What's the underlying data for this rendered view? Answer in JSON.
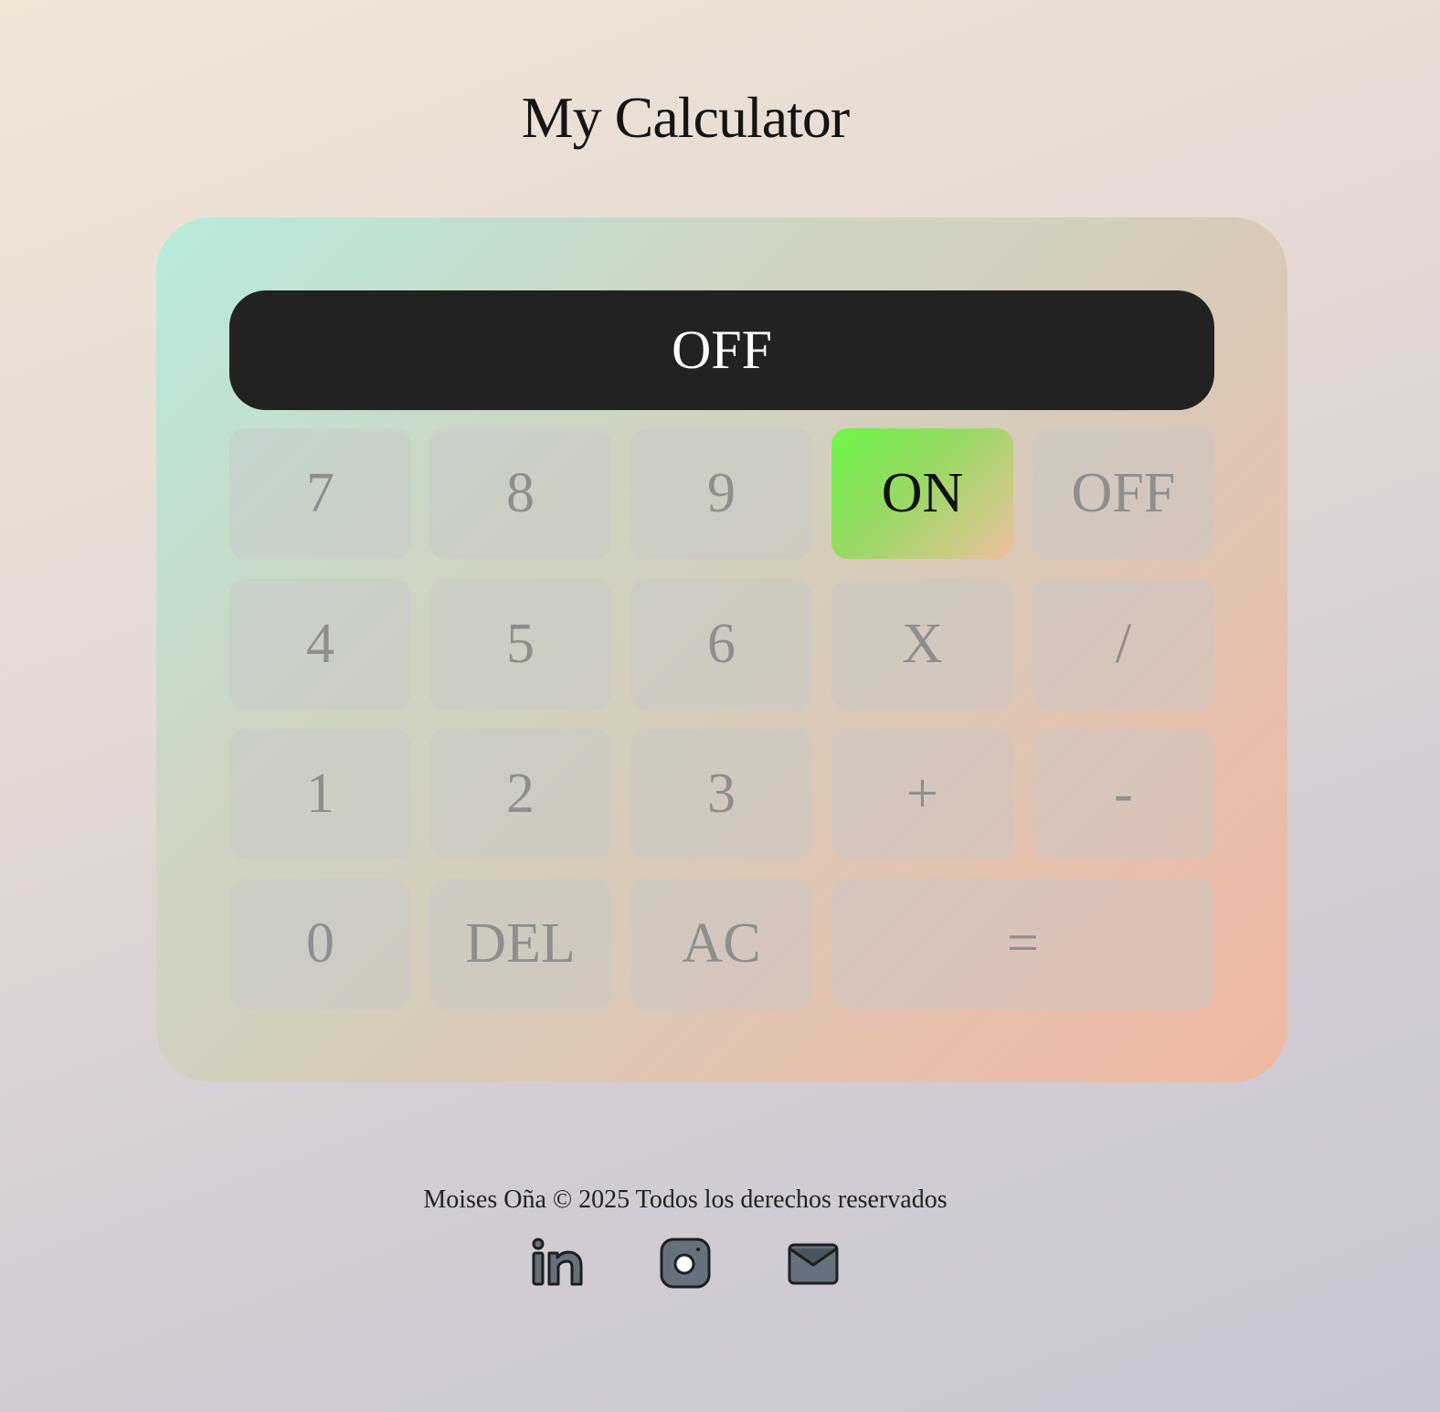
{
  "header": {
    "title": "My Calculator"
  },
  "display": {
    "value": "OFF"
  },
  "keys": {
    "k7": "7",
    "k8": "8",
    "k9": "9",
    "on": "ON",
    "off": "OFF",
    "k4": "4",
    "k5": "5",
    "k6": "6",
    "multiply": "X",
    "divide": "/",
    "k1": "1",
    "k2": "2",
    "k3": "3",
    "plus": "+",
    "minus": "-",
    "k0": "0",
    "del": "DEL",
    "ac": "AC",
    "equals": "="
  },
  "footer": {
    "text": "Moises Oña © 2025 Todos los derechos reservados",
    "icons": [
      "linkedin-icon",
      "instagram-icon",
      "mail-icon"
    ]
  },
  "colors": {
    "display_bg": "#222222",
    "on_key_accent": "#6cf646",
    "icon_fill": "#66717e"
  }
}
